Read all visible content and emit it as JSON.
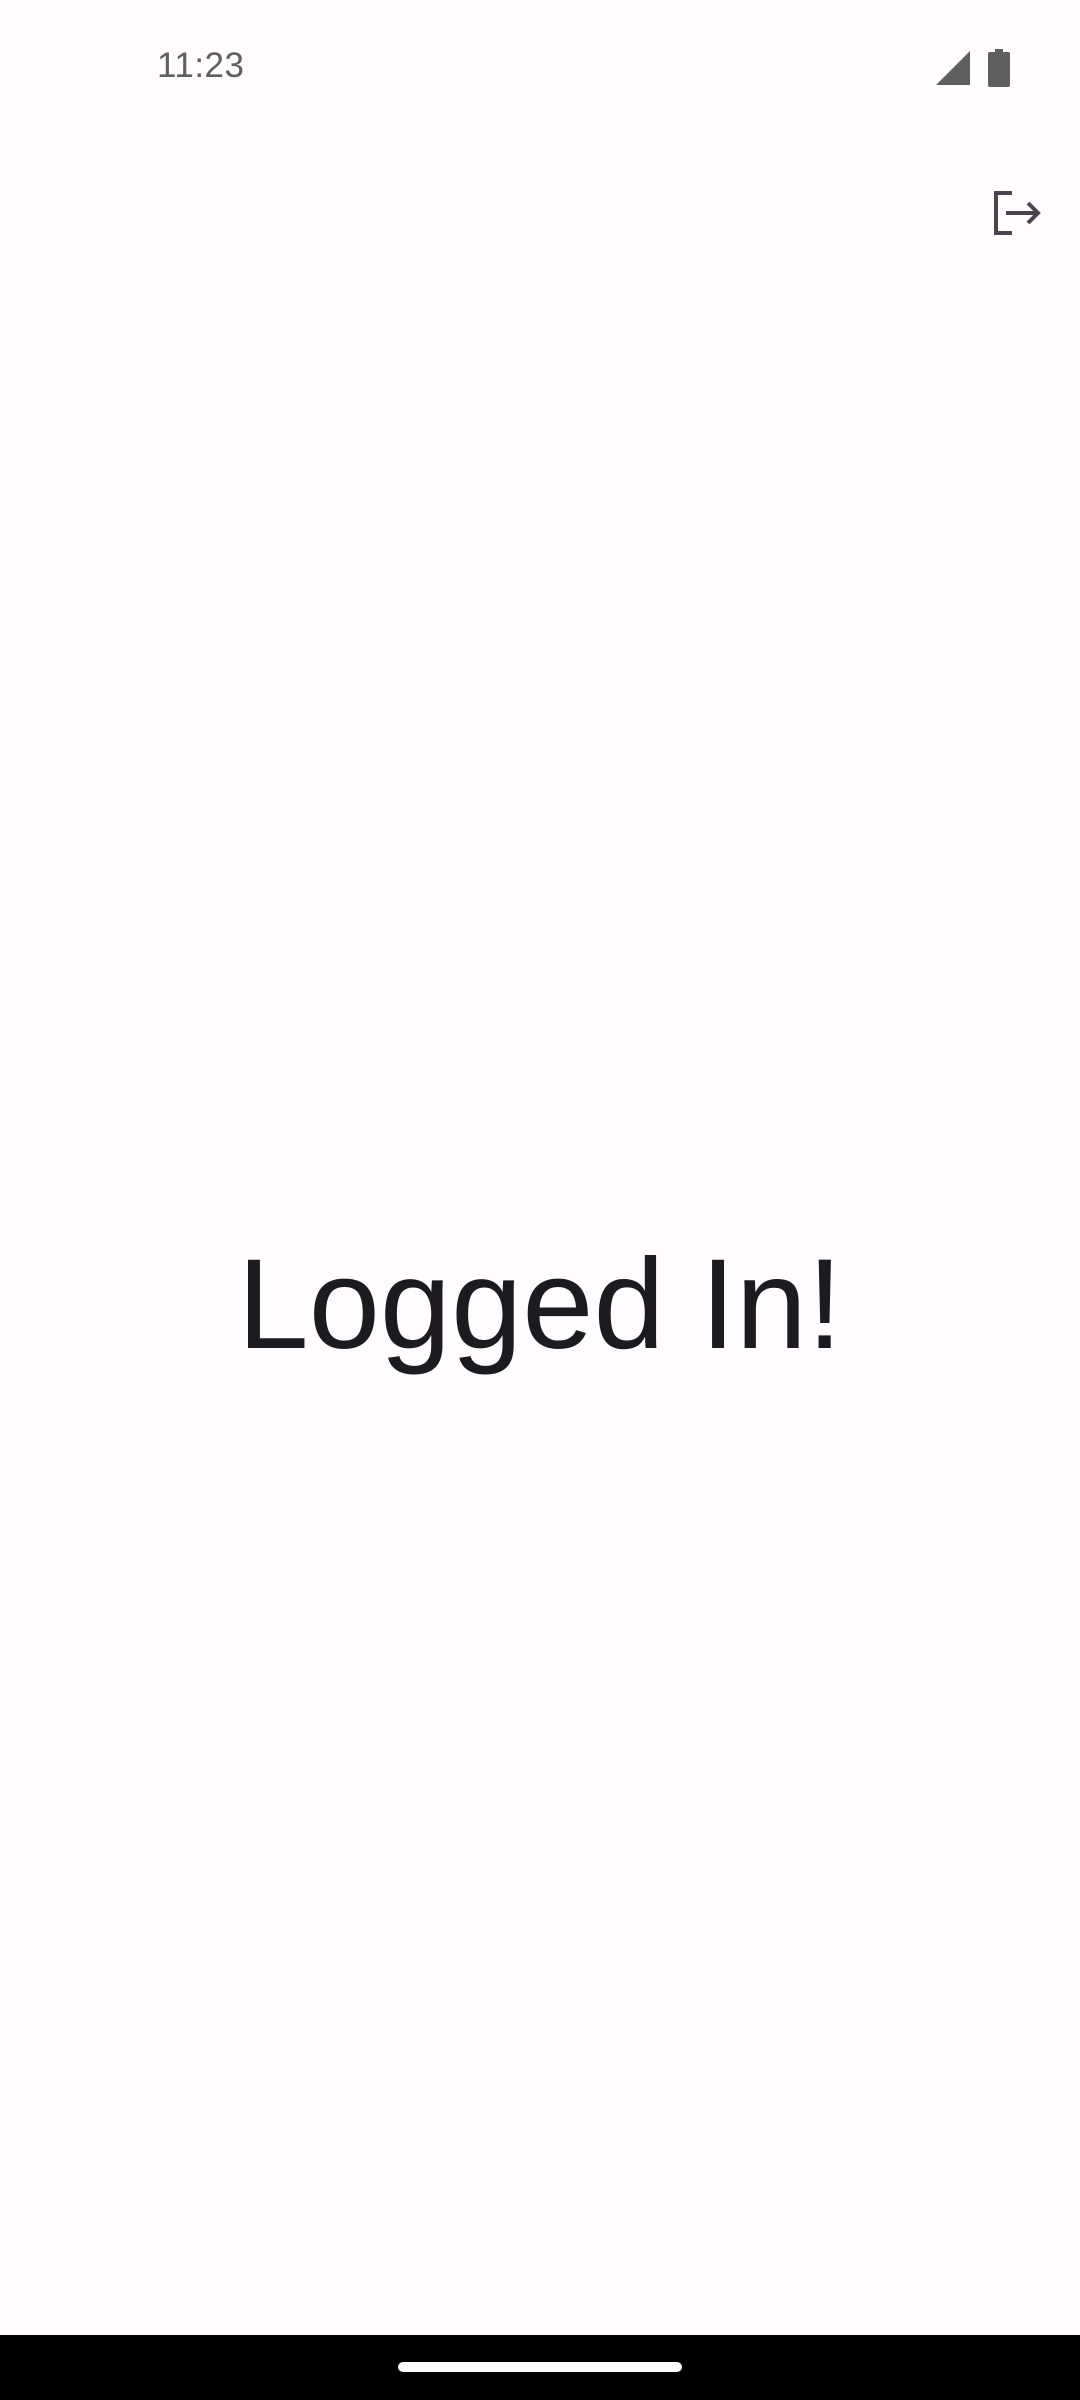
{
  "status_bar": {
    "time": "11:23",
    "icons": [
      "cell-signal-icon",
      "battery-icon"
    ]
  },
  "toolbar": {
    "logout_icon": "logout-icon"
  },
  "main": {
    "message": "Logged In!"
  },
  "colors": {
    "background": "#fffbfe",
    "text": "#1c1b1f",
    "icon": "#49454f",
    "status_icon": "#5f5f5f",
    "nav_bar": "#000000"
  }
}
